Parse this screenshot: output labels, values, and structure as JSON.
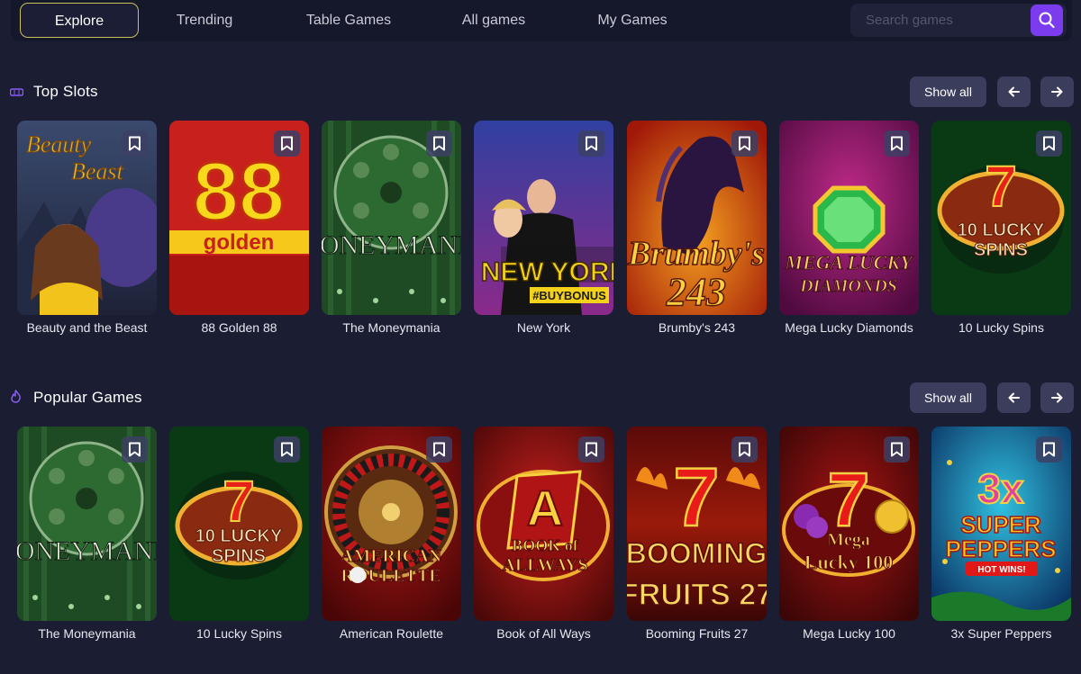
{
  "nav": {
    "tabs": [
      {
        "label": "Explore",
        "active": true
      },
      {
        "label": "Trending",
        "active": false
      },
      {
        "label": "Table Games",
        "active": false
      },
      {
        "label": "All games",
        "active": false
      },
      {
        "label": "My Games",
        "active": false
      }
    ],
    "search": {
      "placeholder": "Search games",
      "icon": "search-icon"
    }
  },
  "sections": [
    {
      "title": "Top Slots",
      "icon": "slots-icon",
      "show_all_label": "Show all",
      "games": [
        {
          "title": "Beauty and the Beast",
          "art_text": "Beauty Beast"
        },
        {
          "title": "88 Golden 88",
          "art_text": "88"
        },
        {
          "title": "The Moneymania",
          "art_text": "MONEYMANIA"
        },
        {
          "title": "New York",
          "art_text": "NEW YORK"
        },
        {
          "title": "Brumby's 243",
          "art_text": "Brumby's 243"
        },
        {
          "title": "Mega Lucky Diamonds",
          "art_text": "MEGA LUCKY DIAMONDS"
        },
        {
          "title": "10 Lucky Spins",
          "art_text": "10 LUCKY SPINS"
        }
      ]
    },
    {
      "title": "Popular Games",
      "icon": "flame-icon",
      "show_all_label": "Show all",
      "games": [
        {
          "title": "The Moneymania",
          "art_text": "MONEYMANIA"
        },
        {
          "title": "10 Lucky Spins",
          "art_text": "10 LUCKY SPINS"
        },
        {
          "title": "American Roulette",
          "art_text": "AMERICAN ROULETTE"
        },
        {
          "title": "Book of All Ways",
          "art_text": "BOOK of ALLWAYS"
        },
        {
          "title": "Booming Fruits 27",
          "art_text": "BOOMING FRUITS 27"
        },
        {
          "title": "Mega Lucky 100",
          "art_text": "Mega Lucky 100"
        },
        {
          "title": "3x Super Peppers",
          "art_text": "3x SUPER PEPPERS"
        }
      ]
    }
  ],
  "colors": {
    "background": "#1b1d33",
    "nav_bg": "#15172a",
    "accent": "#7b3cf0",
    "active_tab_border": "#c9c25a",
    "button_bg": "#3a3d5c"
  }
}
